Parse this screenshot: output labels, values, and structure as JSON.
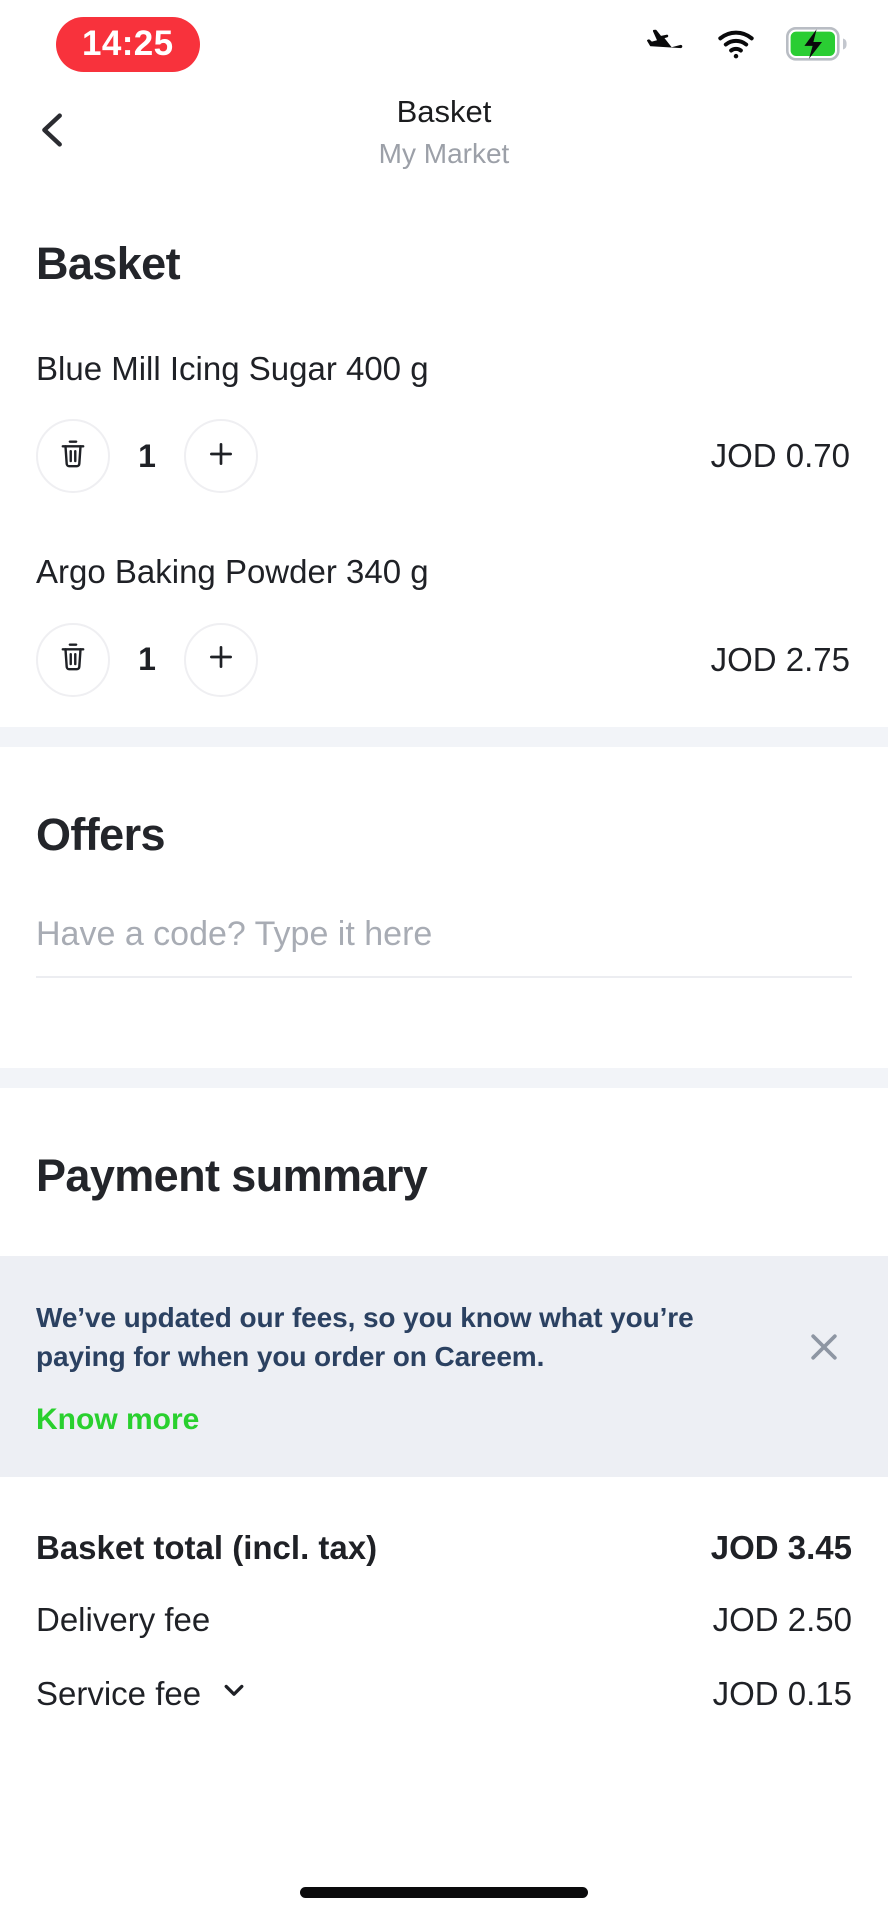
{
  "status_bar": {
    "time": "14:25",
    "time_pill_color": "#F8323C",
    "icons": [
      "airplane-mode-icon",
      "wifi-icon",
      "battery-charging-icon"
    ],
    "battery_color": "#2ACD33"
  },
  "nav": {
    "back_icon": "chevron-left-icon",
    "title": "Basket",
    "subtitle": "My Market"
  },
  "basket": {
    "heading": "Basket",
    "items": [
      {
        "name": "Blue Mill Icing Sugar 400 g",
        "quantity": "1",
        "price": "JOD 0.70",
        "remove_icon": "trash-icon",
        "add_icon": "plus-icon"
      },
      {
        "name": "Argo Baking Powder 340 g",
        "quantity": "1",
        "price": "JOD 2.75",
        "remove_icon": "trash-icon",
        "add_icon": "plus-icon"
      }
    ]
  },
  "offers": {
    "heading": "Offers",
    "promo_placeholder": "Have a code? Type it here",
    "promo_value": ""
  },
  "payment_summary": {
    "heading": "Payment summary",
    "notice": {
      "text": "We’ve updated our fees, so you know what you’re paying for when you order on Careem.",
      "link_label": "Know more",
      "link_color": "#29D02E",
      "text_color": "#2B4161",
      "background": "#EDEFF4",
      "close_icon": "close-icon"
    },
    "rows": [
      {
        "label": "Basket total (incl. tax)",
        "value": "JOD 3.45",
        "bold": true,
        "expand_icon": ""
      },
      {
        "label": "Delivery fee",
        "value": "JOD 2.50",
        "bold": false,
        "expand_icon": ""
      },
      {
        "label": "Service fee",
        "value": "JOD 0.15",
        "bold": false,
        "expand_icon": "chevron-down-icon"
      }
    ]
  },
  "system": {
    "home_indicator": "home-indicator"
  }
}
